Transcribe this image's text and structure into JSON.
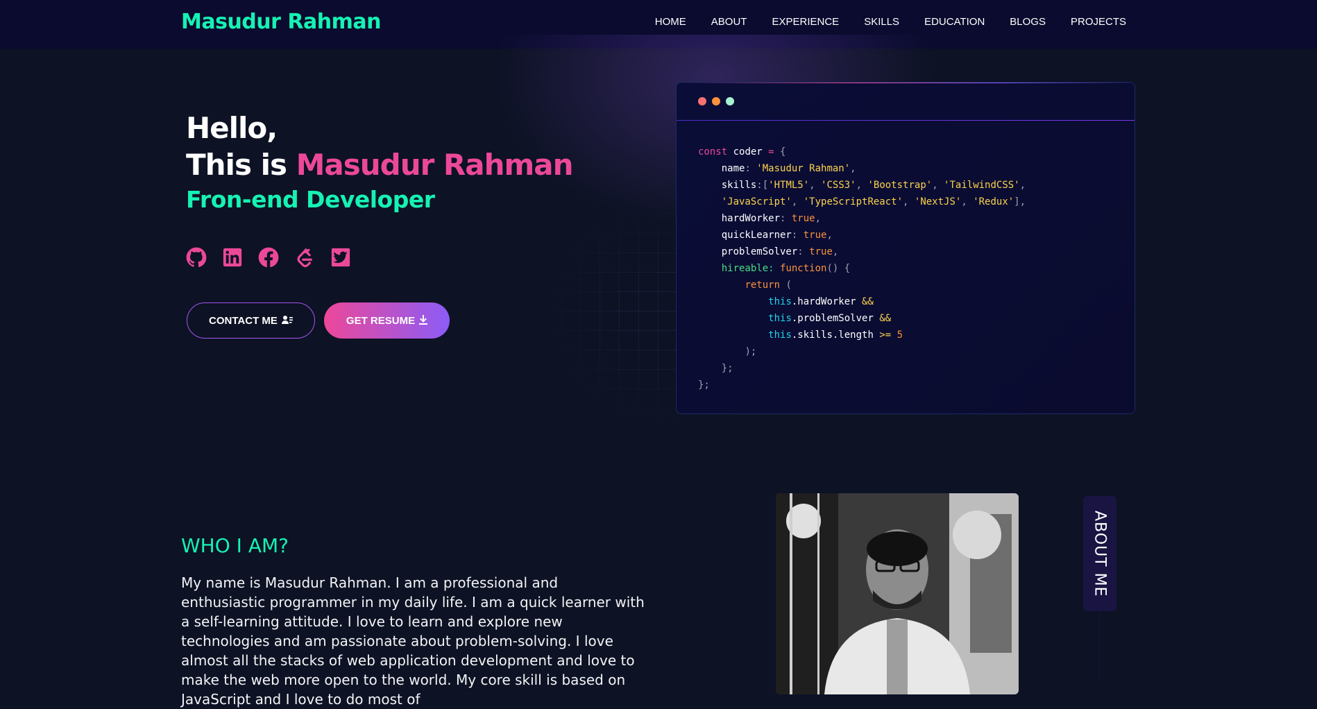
{
  "nav": {
    "brand": "Masudur Rahman",
    "links": [
      "HOME",
      "ABOUT",
      "EXPERIENCE",
      "SKILLS",
      "EDUCATION",
      "BLOGS",
      "PROJECTS"
    ]
  },
  "hero": {
    "hello": "Hello,",
    "this_is": "This is ",
    "name": "Masudur Rahman",
    "role": "Fron-end Developer",
    "socials": [
      "github-icon",
      "linkedin-icon",
      "facebook-icon",
      "leetcode-icon",
      "twitter-icon"
    ],
    "contact_label": "CONTACT ME",
    "resume_label": "GET RESUME"
  },
  "code": {
    "l1a": "const",
    "l1b": " coder ",
    "l1c": "=",
    "l1d": " {",
    "l2a": "name",
    "l2b": ": ",
    "l2c": "'Masudur Rahman'",
    "l2d": ",",
    "l3a": "skills",
    "l3b": ":[",
    "l3c1": "'HTML5'",
    "l3c2": "'CSS3'",
    "l3c3": "'Bootstrap'",
    "l3c4": "'TailwindCSS'",
    "l4c1": "'JavaScript'",
    "l4c2": "'TypeScriptReact'",
    "l4c3": "'NextJS'",
    "l4c4": "'Redux'",
    "l4e": "],",
    "l5a": "hardWorker",
    "l5b": ": ",
    "l5c": "true",
    "l5d": ",",
    "l6a": "quickLearner",
    "l6b": ": ",
    "l6c": "true",
    "l6d": ",",
    "l7a": "problemSolver",
    "l7b": ": ",
    "l7c": "true",
    "l7d": ",",
    "l8a": "hireable",
    "l8b": ": ",
    "l8c": "function",
    "l8d": "() {",
    "l9a": "return",
    "l9b": " (",
    "l10a": "this",
    "l10b": ".hardWorker ",
    "l10c": "&&",
    "l11a": "this",
    "l11b": ".problemSolver ",
    "l11c": "&&",
    "l12a": "this",
    "l12b": ".skills.length ",
    "l12c": ">=",
    "l12d": " 5",
    "l13": ");",
    "l14": "};",
    "l15": "};"
  },
  "about": {
    "heading": "WHO I AM?",
    "paragraph": "My name is Masudur Rahman. I am a professional and enthusiastic programmer in my daily life. I am a quick learner with a self-learning attitude. I love to learn and explore new technologies and am passionate about problem-solving. I love almost all the stacks of web application development and love to make the web more open to the world. My core skill is based on JavaScript and I love to do most of",
    "tab_label": "ABOUT ME"
  },
  "colors": {
    "accent_green": "#16f2b3",
    "accent_pink": "#ec4899",
    "accent_purple": "#8b5cf6",
    "background": "#0d1224",
    "nav_background": "#0a0b2e"
  }
}
